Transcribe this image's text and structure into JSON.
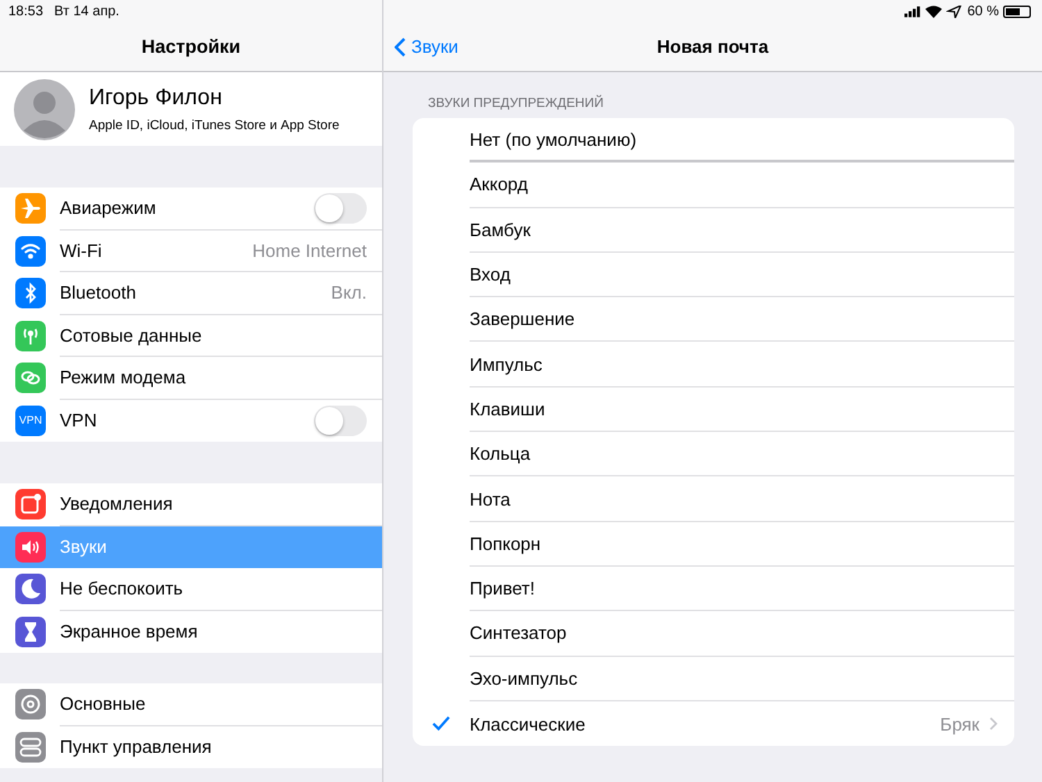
{
  "status_bar": {
    "time": "18:53",
    "date": "Вт 14 апр.",
    "battery_text": "60 %"
  },
  "sidebar": {
    "title": "Настройки",
    "profile": {
      "name": "Игорь Филон",
      "subtitle": "Apple ID, iCloud, iTunes Store и App Store"
    },
    "groups": [
      [
        {
          "label": "Авиарежим",
          "color": "#ff9500",
          "kind": "toggle",
          "on": false,
          "selected": false
        },
        {
          "label": "Wi-Fi",
          "color": "#007aff",
          "kind": "value",
          "value": "Home Internet",
          "selected": false
        },
        {
          "label": "Bluetooth",
          "color": "#007aff",
          "kind": "value",
          "value": "Вкл.",
          "selected": false
        },
        {
          "label": "Сотовые данные",
          "color": "#34c759",
          "kind": "plain",
          "selected": false
        },
        {
          "label": "Режим модема",
          "color": "#34c759",
          "kind": "plain",
          "selected": false
        },
        {
          "label": "VPN",
          "icon_text": "VPN",
          "color": "#007aff",
          "kind": "toggle",
          "on": false,
          "selected": false
        }
      ],
      [
        {
          "label": "Уведомления",
          "color": "#ff3b30",
          "kind": "plain",
          "selected": false
        },
        {
          "label": "Звуки",
          "color": "#ff2d55",
          "kind": "plain",
          "selected": true
        },
        {
          "label": "Не беспокоить",
          "color": "#5856d6",
          "kind": "plain",
          "selected": false
        },
        {
          "label": "Экранное время",
          "color": "#5856d6",
          "kind": "plain",
          "selected": false
        }
      ],
      [
        {
          "label": "Основные",
          "color": "#8e8e93",
          "kind": "plain",
          "selected": false
        },
        {
          "label": "Пункт управления",
          "color": "#8e8e93",
          "kind": "plain",
          "selected": false
        }
      ]
    ]
  },
  "detail": {
    "back": "Звуки",
    "title": "Новая почта",
    "section_header": "ЗВУКИ ПРЕДУПРЕЖДЕНИЙ",
    "items": [
      {
        "label": "Нет (по умолчанию)",
        "checked": false
      },
      {
        "label": "Аккорд",
        "checked": false
      },
      {
        "label": "Бамбук",
        "checked": false
      },
      {
        "label": "Вход",
        "checked": false
      },
      {
        "label": "Завершение",
        "checked": false
      },
      {
        "label": "Импульс",
        "checked": false
      },
      {
        "label": "Клавиши",
        "checked": false
      },
      {
        "label": "Кольца",
        "checked": false
      },
      {
        "label": "Нота",
        "checked": false
      },
      {
        "label": "Попкорн",
        "checked": false
      },
      {
        "label": "Привет!",
        "checked": false
      },
      {
        "label": "Синтезатор",
        "checked": false
      },
      {
        "label": "Эхо-импульс",
        "checked": false
      },
      {
        "label": "Классические",
        "checked": true,
        "value": "Бряк"
      }
    ]
  }
}
